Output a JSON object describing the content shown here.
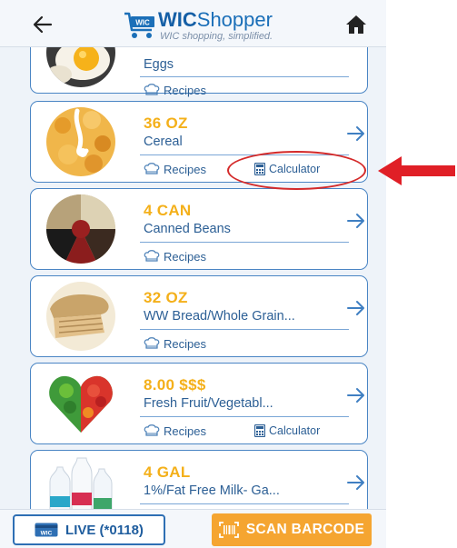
{
  "header": {
    "app_name_bold": "WIC",
    "app_name_rest": "Shopper",
    "logo_cart_text": "WIC",
    "tagline": "WIC shopping, simplified."
  },
  "items": [
    {
      "qty": "",
      "name": "Eggs",
      "recipes_label": "Recipes",
      "calculator_label": "",
      "image": "eggs"
    },
    {
      "qty": "36 OZ",
      "name": "Cereal",
      "recipes_label": "Recipes",
      "calculator_label": "Calculator",
      "image": "cereal"
    },
    {
      "qty": "4 CAN",
      "name": "Canned Beans",
      "recipes_label": "Recipes",
      "calculator_label": "",
      "image": "beans"
    },
    {
      "qty": "32 OZ",
      "name": "WW Bread/Whole Grain...",
      "recipes_label": "Recipes",
      "calculator_label": "",
      "image": "bread"
    },
    {
      "qty": "8.00 $$$",
      "name": "Fresh Fruit/Vegetabl...",
      "recipes_label": "Recipes",
      "calculator_label": "Calculator",
      "image": "produce"
    },
    {
      "qty": "4 GAL",
      "name": "1%/Fat Free Milk- Ga...",
      "recipes_label": "",
      "calculator_label": "",
      "image": "milk"
    }
  ],
  "footer": {
    "live_badge": "WIC",
    "live_label": "LIVE (*0118)",
    "scan_label": "SCAN BARCODE"
  },
  "colors": {
    "accent_blue": "#2e6fb4",
    "quantity_yellow": "#f4b01a",
    "scan_orange": "#f5a531",
    "annotation_red": "#d42a2a"
  },
  "icons": {
    "back": "arrow-left-icon",
    "home": "home-icon",
    "recipes": "chef-hat-icon",
    "calculator": "calculator-icon",
    "item_arrow": "arrow-right-icon",
    "scan": "barcode-icon"
  }
}
